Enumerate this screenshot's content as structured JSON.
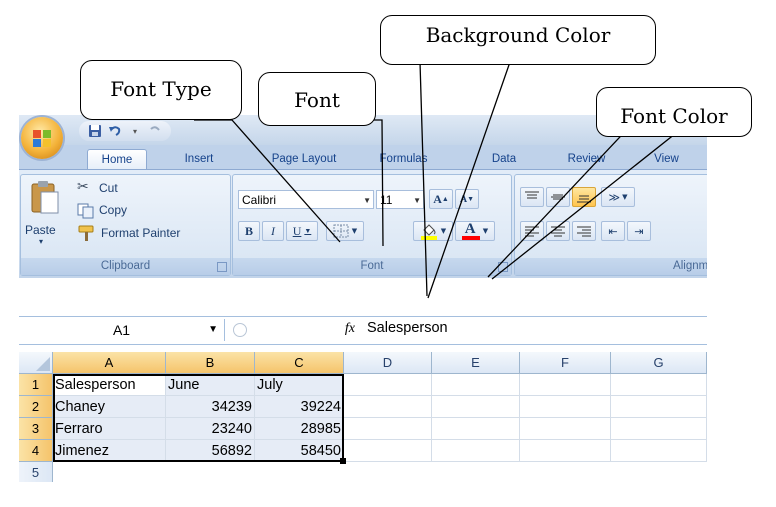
{
  "callouts": {
    "font_type": "Font Type",
    "font": "Font",
    "background_color": "Background Color",
    "font_color": "Font Color"
  },
  "ribbon": {
    "tabs": [
      "Home",
      "Insert",
      "Page Layout",
      "Formulas",
      "Data",
      "Review",
      "View"
    ],
    "active_tab": "Home",
    "clipboard": {
      "paste_label": "Paste",
      "cut_label": "Cut",
      "copy_label": "Copy",
      "format_painter_label": "Format Painter",
      "group_label": "Clipboard"
    },
    "font": {
      "font_name": "Calibri",
      "font_size": "11",
      "bold": "B",
      "italic": "I",
      "underline": "U",
      "grow": "A",
      "shrink": "A",
      "font_color_glyph": "A",
      "group_label": "Font"
    },
    "alignment": {
      "group_label": "Alignmen"
    },
    "colors": {
      "fill_yellow": "#ffff00",
      "font_red": "#ff0000",
      "accent_blue": "#15428b"
    }
  },
  "formula_bar": {
    "name_box": "A1",
    "fx": "fx",
    "content": "Salesperson"
  },
  "sheet": {
    "columns": [
      "A",
      "B",
      "C",
      "D",
      "E",
      "F",
      "G"
    ],
    "rows": [
      {
        "num": "1",
        "cells": [
          "Salesperson",
          "June",
          "July"
        ]
      },
      {
        "num": "2",
        "cells": [
          "Chaney",
          "34239",
          "39224"
        ]
      },
      {
        "num": "3",
        "cells": [
          "Ferraro",
          "23240",
          "28985"
        ]
      },
      {
        "num": "4",
        "cells": [
          "Jimenez",
          "56892",
          "58450"
        ]
      },
      {
        "num": "5",
        "cells": [
          "",
          "",
          ""
        ]
      }
    ]
  }
}
